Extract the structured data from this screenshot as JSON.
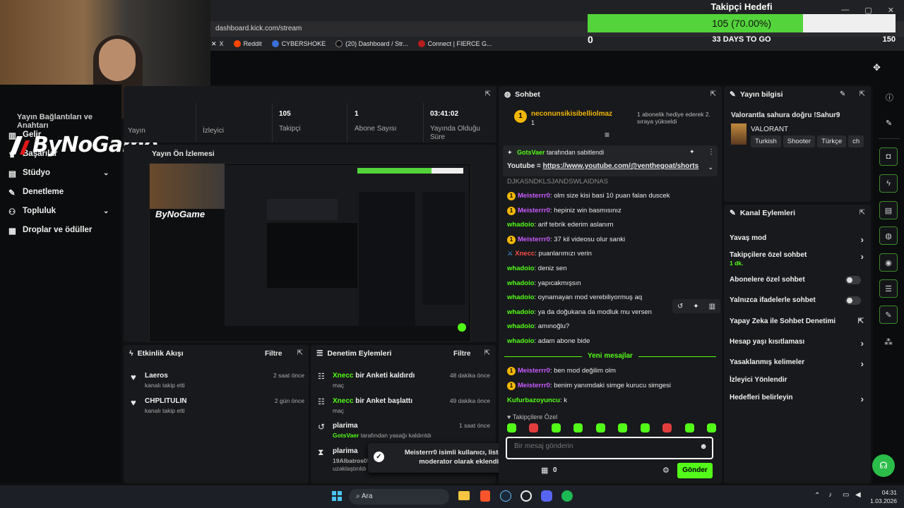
{
  "browser": {
    "url": "dashboard.kick.com/stream",
    "bookmarks": [
      "X",
      "Reddit",
      "CYBERSHOKE",
      "(20) Dashboard / Str...",
      "Connect | FIERCE G..."
    ]
  },
  "goal": {
    "title": "Takipçi Hedefi",
    "current": 105,
    "target": 150,
    "percent": 70.0,
    "label": "105 (70.00%)",
    "min_label": "0",
    "max_label": "150",
    "days_left": "33 DAYS TO GO"
  },
  "logo": "ByNoGame",
  "sidebar": {
    "partial_text": "Yayın Bağlantıları ve Anahtarı",
    "items": [
      {
        "label": "Gelir",
        "icon": "chart-icon"
      },
      {
        "label": "Başarılar",
        "icon": "trophy-icon"
      },
      {
        "label": "Stüdyo",
        "icon": "studio-icon"
      },
      {
        "label": "Denetleme",
        "icon": "wrench-icon"
      },
      {
        "label": "Topluluk",
        "icon": "people-icon"
      },
      {
        "label": "Droplar ve ödüller",
        "icon": "gift-icon"
      }
    ]
  },
  "stats": [
    {
      "value": "",
      "label": "Yayın"
    },
    {
      "value": "",
      "label": "İzleyici"
    },
    {
      "value": "105",
      "label": "Takipçi"
    },
    {
      "value": "1",
      "label": "Abone Sayısı"
    },
    {
      "value": "03:41:02",
      "label": "Yayında Olduğu Süre"
    }
  ],
  "preview": {
    "title": "Yayın Ön İzlemesi"
  },
  "activity": {
    "title": "Etkinlik Akışı",
    "filter": "Filtre",
    "items": [
      {
        "name": "Laeros",
        "sub": "kanalı takip etti",
        "time": "2 saat önce"
      },
      {
        "name": "CHPLITULIN",
        "sub": "kanalı takip etti",
        "time": "2 gün önce"
      }
    ]
  },
  "moderation": {
    "title": "Denetim Eylemleri",
    "filter": "Filtre",
    "items": [
      {
        "actor": "Xnecc",
        "action": " bir Anketi kaldırdı",
        "sub": "maç",
        "time": "48 dakika önce"
      },
      {
        "actor": "Xnecc",
        "action": " bir Anket başlattı",
        "sub": "maç",
        "time": "49 dakika önce"
      },
      {
        "actor": "plarima",
        "action": "",
        "sub_actor": "GotsVaer",
        "sub": " tarafından yasağı kaldırıldı",
        "time": "1 saat önce"
      },
      {
        "actor": "plarima",
        "action": "",
        "sub_actor": "19Albatros05",
        "sub": "uzaklaştırıldı",
        "time": ""
      }
    ]
  },
  "toast": {
    "text": "Meisterrr0 isimli kullanıcı, listenize moderator olarak eklendi."
  },
  "chat": {
    "title": "Sohbet",
    "top_gifter": {
      "name": "neconunsikisibelliolmaz",
      "count": "1",
      "note": "1 abonelik hediye ederek 2. sıraya yükseldi"
    },
    "pinned": {
      "by": "GotsVaer",
      "by_suffix": "tarafından sabitlendi",
      "text": "Youtube = ",
      "link": "https://www.youtube.com/@venthegoat/shorts"
    },
    "partial_line": "DJKASNDKLSJANDSWLAIDNAS",
    "messages": [
      {
        "user": "Meisterrr0",
        "text": ": olm size kisi basi 10 puan falan duscek",
        "badge": true,
        "color": "purple"
      },
      {
        "user": "Meisterrr0",
        "text": ": hepiniz win basmısınız",
        "badge": true,
        "color": "purple"
      },
      {
        "user": "whadoio",
        "text": ": arif tebrik ederim aslanım",
        "badge": false,
        "color": "green"
      },
      {
        "user": "Meisterrr0",
        "text": ": 37 kil videosu olur sanki",
        "badge": true,
        "color": "purple"
      },
      {
        "user": "Xnecc",
        "text": ": puanlarımızı verin",
        "badge": false,
        "color": "red",
        "mod": true
      },
      {
        "user": "whadoio",
        "text": ": deniz sen",
        "badge": false,
        "color": "green"
      },
      {
        "user": "whadoio",
        "text": ": yapıcakmışsın",
        "badge": false,
        "color": "green"
      },
      {
        "user": "whadoio",
        "text": ": oynamayan mod verebiliyormuş aq",
        "badge": false,
        "color": "green"
      },
      {
        "user": "whadoio",
        "text": ": ya da doğukana da modluk mu versen",
        "badge": false,
        "color": "green"
      },
      {
        "user": "whadoio",
        "text": ": amınoğlu?",
        "badge": false,
        "color": "green"
      },
      {
        "user": "whadoio",
        "text": ": adam abone bide",
        "badge": false,
        "color": "green"
      }
    ],
    "new_messages_label": "Yeni mesajlar",
    "new_messages": [
      {
        "user": "Meisterrr0",
        "text": ": ben mod değilim olm",
        "badge": true,
        "color": "purple"
      },
      {
        "user": "Meisterrr0",
        "text": ": benim yanımdaki simge kurucu simgesi",
        "badge": true,
        "color": "purple"
      },
      {
        "user": "Kufurbazoyuncu",
        "text": ": k",
        "badge": false,
        "color": "green"
      }
    ],
    "emote_section": "Takipçilere Özel",
    "input_placeholder": "Bir mesaj gönderin",
    "points": "0",
    "send": "Gönder"
  },
  "stream_info": {
    "title": "Yayın bilgisi",
    "stream_title": "Valorantla sahura doğru !Sahur9",
    "game": "VALORANT",
    "tags": [
      "Turkish",
      "Shooter",
      "Türkçe",
      "ch"
    ]
  },
  "channel_actions": {
    "title": "Kanal Eylemleri",
    "rows": [
      {
        "label": "Yavaş mod",
        "control": "arrow"
      },
      {
        "label": "Takipçilere özel sohbet",
        "sub": "1 dk.",
        "control": "arrow"
      },
      {
        "label": "Abonelere özel sohbet",
        "control": "toggle"
      },
      {
        "label": "Yalnızca ifadelerle sohbet",
        "control": "toggle"
      },
      {
        "label": "Yapay Zeka ile Sohbet Denetimi",
        "control": "external"
      },
      {
        "label": "Hesap yaşı kısıtlaması",
        "control": "arrow"
      },
      {
        "label": "Yasaklanmış kelimeler",
        "control": "arrow"
      },
      {
        "label": "İzleyici Yönlendir",
        "control": "none"
      },
      {
        "label": "Hedefleri belirleyin",
        "control": "arrow"
      }
    ]
  },
  "taskbar": {
    "search": "Ara",
    "time": "04:31",
    "date": "1.03.2026"
  },
  "colors": {
    "kick_green": "#53fc18",
    "purple": "#c85bff",
    "panel": "#18191c"
  }
}
